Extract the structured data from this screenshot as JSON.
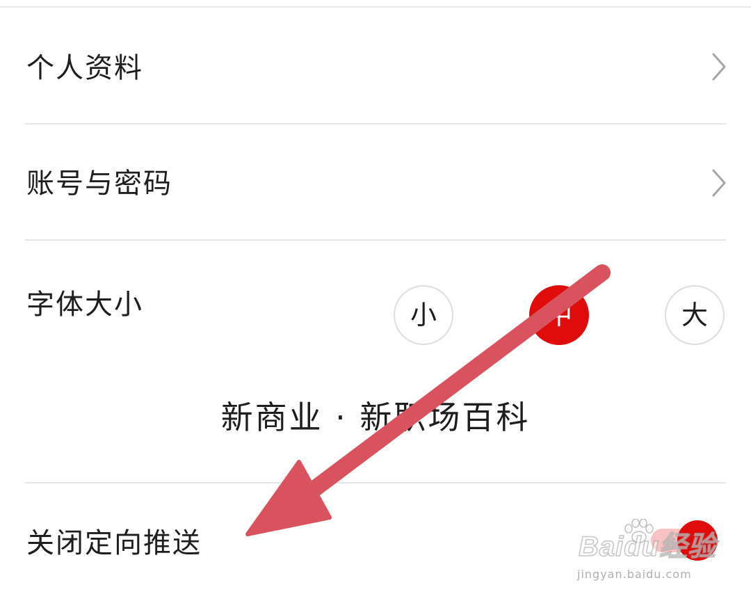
{
  "settings": {
    "items": [
      {
        "label": "个人资料"
      },
      {
        "label": "账号与密码"
      }
    ],
    "font_size": {
      "label": "字体大小",
      "options": [
        "小",
        "中",
        "大"
      ],
      "selected": "中",
      "preview": "新商业 · 新职场百科"
    },
    "targeted_push": {
      "label": "关闭定向推送",
      "enabled": true
    }
  },
  "colors": {
    "accent": "#e00b0b",
    "annotation_arrow": "#d9535f"
  },
  "icons": {
    "chevron": "chevron-right-icon",
    "arrow": "annotation-arrow-icon",
    "watermark_paw": "baidu-paw-icon"
  },
  "watermark": {
    "logo": "Baidu经验",
    "url": "jingyan.baidu.com"
  }
}
